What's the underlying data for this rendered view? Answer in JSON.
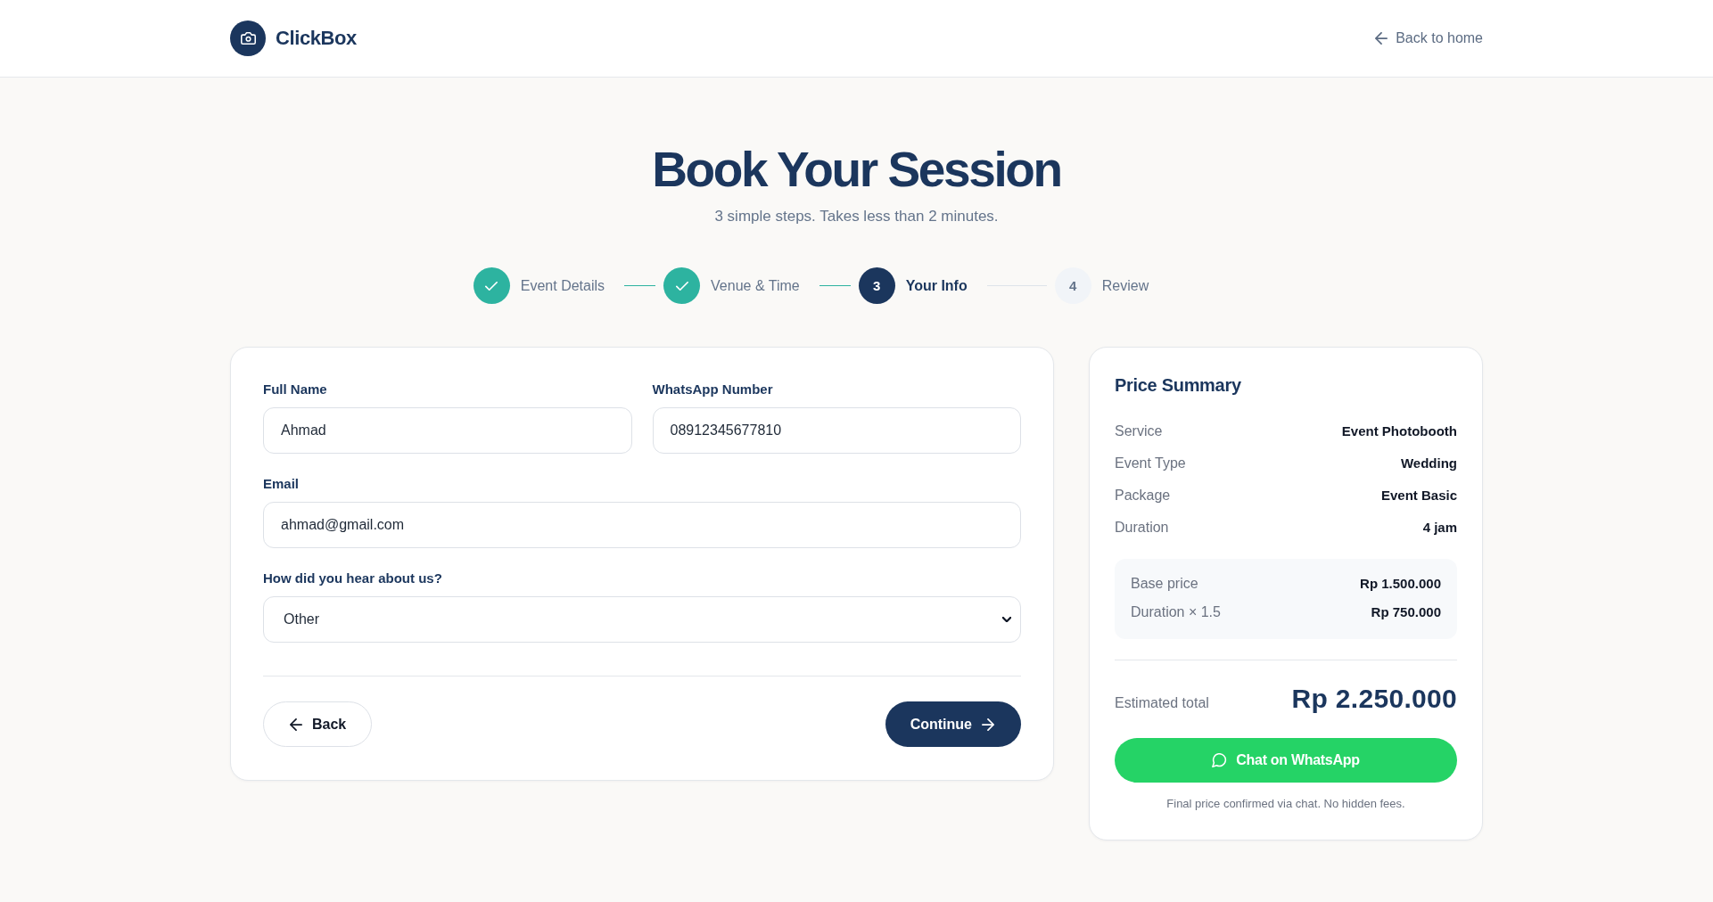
{
  "header": {
    "brand": "ClickBox",
    "back_link": "Back to home"
  },
  "hero": {
    "title": "Book Your Session",
    "subtitle": "3 simple steps. Takes less than 2 minutes."
  },
  "steps": [
    {
      "label": "Event Details",
      "completed": true,
      "selected": false
    },
    {
      "label": "Venue & Time",
      "completed": true,
      "selected": false
    },
    {
      "label": "Your Info",
      "number": "3",
      "completed": false,
      "selected": true
    },
    {
      "label": "Review",
      "number": "4",
      "completed": false,
      "selected": false
    }
  ],
  "form": {
    "rows": [
      {
        "fields": [
          {
            "kind": "input",
            "label": "Full Name",
            "value": "Ahmad"
          },
          {
            "kind": "input",
            "label": "WhatsApp Number",
            "value": "08912345677810"
          }
        ]
      },
      {
        "fields": [
          {
            "kind": "input",
            "label": "Email",
            "value": "ahmad@gmail.com"
          }
        ]
      },
      {
        "fields": [
          {
            "kind": "select",
            "label": "How did you hear about us?",
            "value": "Other"
          }
        ]
      }
    ],
    "back_button": "Back",
    "continue_button": "Continue"
  },
  "price_summary": {
    "title": "Price Summary",
    "details": [
      {
        "label": "Service",
        "value": "Event Photobooth"
      },
      {
        "label": "Event Type",
        "value": "Wedding"
      },
      {
        "label": "Package",
        "value": "Event Basic"
      },
      {
        "label": "Duration",
        "value": "4 jam"
      }
    ],
    "breakdown": [
      {
        "label": "Base price",
        "value": "Rp 1.500.000"
      },
      {
        "label": "Duration × 1.5",
        "value": "Rp 750.000"
      }
    ],
    "total": {
      "label": "Estimated total",
      "value": "Rp 2.250.000"
    },
    "whatsapp_button": "Chat on WhatsApp",
    "note": "Final price confirmed via chat. No hidden fees."
  }
}
